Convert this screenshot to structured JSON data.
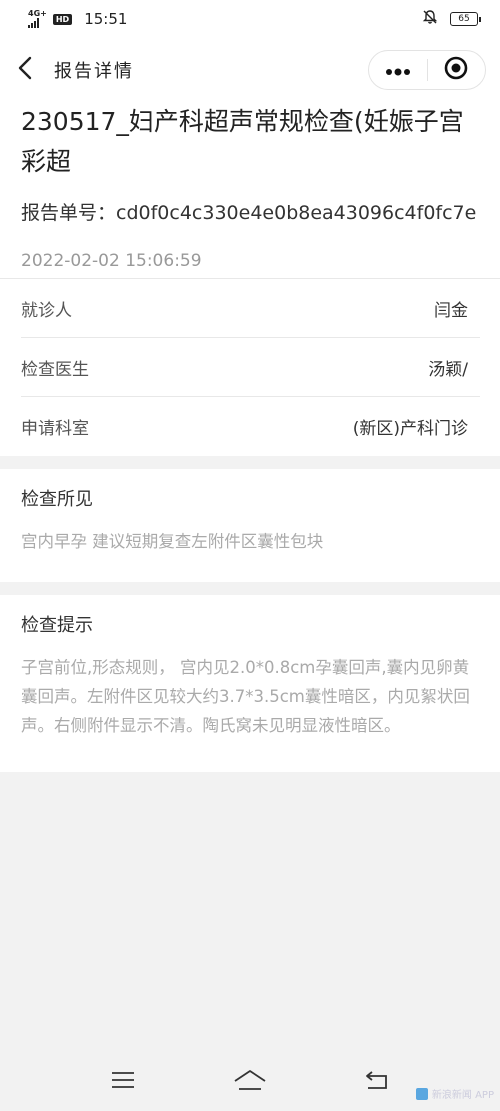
{
  "status_bar": {
    "network": "4G+",
    "hd_badge": "HD",
    "time": "15:51",
    "battery": "65"
  },
  "nav": {
    "title": "报告详情"
  },
  "report": {
    "title": "230517_妇产科超声常规检查(妊娠子宫彩超",
    "number_label": "报告单号：",
    "number_value": "cd0f0c4c330e4e0b8ea43096c4f0fc7e",
    "datetime": "2022-02-02 15:06:59"
  },
  "info_rows": [
    {
      "label": "就诊人",
      "value": "闫金"
    },
    {
      "label": "检查医生",
      "value": "汤颖/"
    },
    {
      "label": "申请科室",
      "value": "(新区)产科门诊"
    }
  ],
  "findings": {
    "title": "检查所见",
    "body": "宫内早孕 建议短期复查左附件区囊性包块"
  },
  "hints": {
    "title": "检查提示",
    "body": "子宫前位,形态规则， 宫内见2.0*0.8cm孕囊回声,囊内见卵黄囊回声。左附件区见较大约3.7*3.5cm囊性暗区，内见絮状回声。右侧附件显示不清。陶氏窝未见明显液性暗区。"
  },
  "watermark": {
    "text": "新浪新闻 APP"
  }
}
